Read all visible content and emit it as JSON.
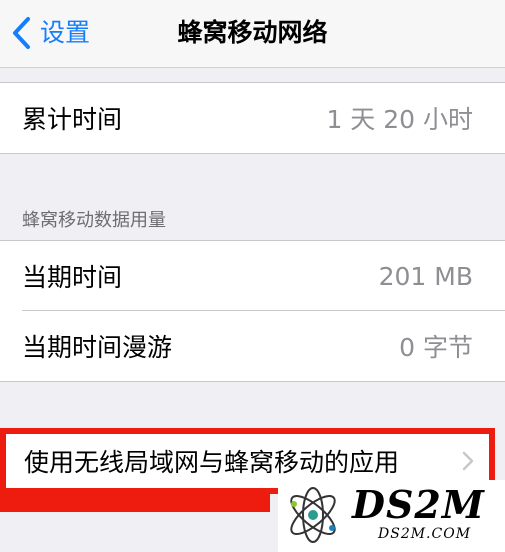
{
  "nav": {
    "back_label": "设置",
    "title": "蜂窝移动网络"
  },
  "usage": {
    "total_time": {
      "label": "累计时间",
      "value": "1 天 20 小时"
    }
  },
  "cellular_data": {
    "header": "蜂窝移动数据用量",
    "rows": [
      {
        "label": "当期时间",
        "value": "201 MB"
      },
      {
        "label": "当期时间漫游",
        "value": "0 字节"
      }
    ]
  },
  "apps": {
    "label": "使用无线局域网与蜂窝移动的应用"
  },
  "watermark": {
    "title": "DS2M",
    "subtitle": "DS2M.COM"
  },
  "colors": {
    "accent": "#157efb",
    "highlight": "#ee1c0e",
    "background": "#efeff4"
  },
  "icons": {
    "back": "chevron-left-icon",
    "disclosure": "chevron-right-icon",
    "logo": "ds2m-logo-icon"
  }
}
